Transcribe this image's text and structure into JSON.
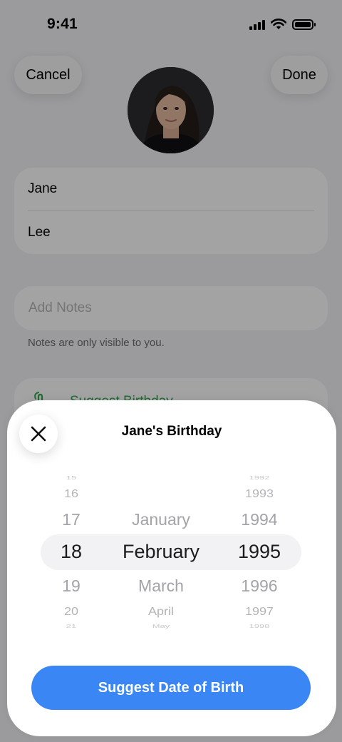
{
  "status_bar": {
    "time": "9:41",
    "icons": [
      "signal-icon",
      "wifi-icon",
      "battery-icon"
    ]
  },
  "header": {
    "cancel_label": "Cancel",
    "done_label": "Done",
    "avatar_icon": "profile-photo"
  },
  "name_card": {
    "first_name": "Jane",
    "last_name": "Lee"
  },
  "notes": {
    "placeholder": "Add Notes",
    "hint": "Notes are only visible to you."
  },
  "suggest_card": {
    "icon": "hand-tap-icon",
    "label": "Suggest Birthday"
  },
  "sheet": {
    "close_icon": "close-icon",
    "title": "Jane's Birthday",
    "picker": {
      "days": [
        "15",
        "16",
        "17",
        "18",
        "19",
        "20",
        "21"
      ],
      "months": [
        "January",
        "February",
        "March",
        "April",
        "May"
      ],
      "years": [
        "1992",
        "1993",
        "1994",
        "1995",
        "1996",
        "1997",
        "1998"
      ],
      "selected": {
        "day": "18",
        "month": "February",
        "year": "1995"
      }
    },
    "cta_label": "Suggest Date of Birth"
  },
  "colors": {
    "accent_blue": "#3A86F5",
    "suggest_green": "#34A852",
    "background": "#F2F2F7"
  }
}
